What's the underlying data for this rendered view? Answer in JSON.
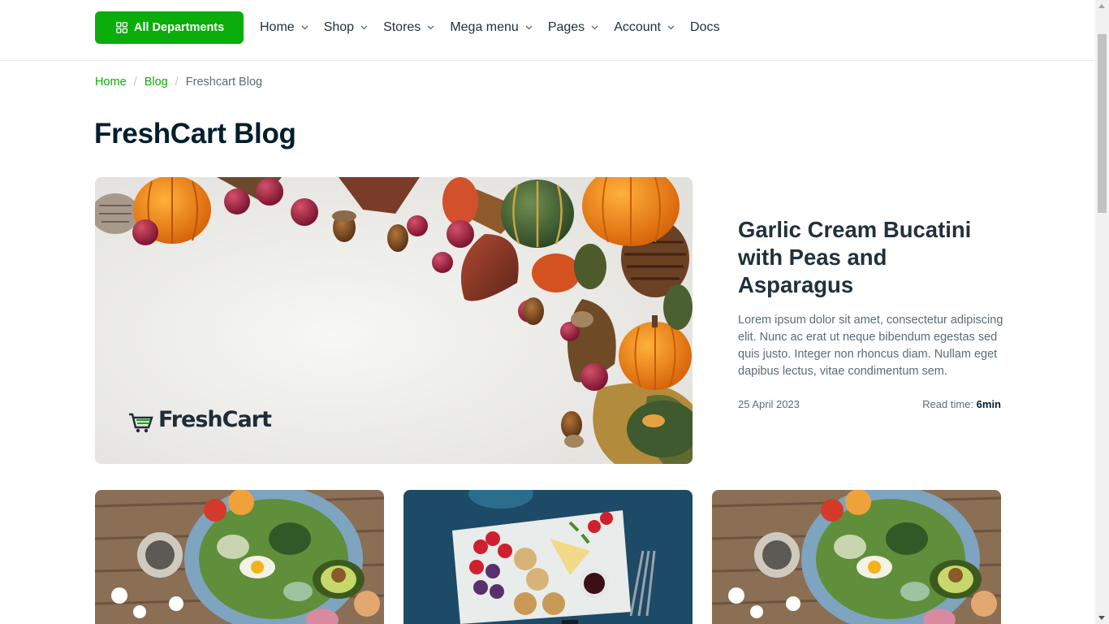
{
  "nav": {
    "departments_label": "All Departments",
    "items": [
      {
        "label": "Home",
        "has_dropdown": true
      },
      {
        "label": "Shop",
        "has_dropdown": true
      },
      {
        "label": "Stores",
        "has_dropdown": true
      },
      {
        "label": "Mega menu",
        "has_dropdown": true
      },
      {
        "label": "Pages",
        "has_dropdown": true
      },
      {
        "label": "Account",
        "has_dropdown": true
      },
      {
        "label": "Docs",
        "has_dropdown": false
      }
    ]
  },
  "breadcrumb": {
    "items": [
      "Home",
      "Blog"
    ],
    "current": "Freshcart Blog"
  },
  "page": {
    "title": "FreshCart Blog"
  },
  "featured": {
    "logo_text": "FreshCart",
    "title": "Garlic Cream Bucatini with Peas and Asparagus",
    "description": "Lorem ipsum dolor sit amet, consectetur adipiscing elit. Nunc ac erat ut neque bibendum egestas sed quis justo. Integer non rhoncus diam. Nullam eget dapibus lectus, vitae condimentum sem.",
    "date": "25 April 2023",
    "read_time_label": "Read time:",
    "read_time_value": "6min"
  },
  "theme": {
    "primary": "#0aad0a",
    "heading": "#001e2b",
    "body_text": "#5c6c75"
  }
}
